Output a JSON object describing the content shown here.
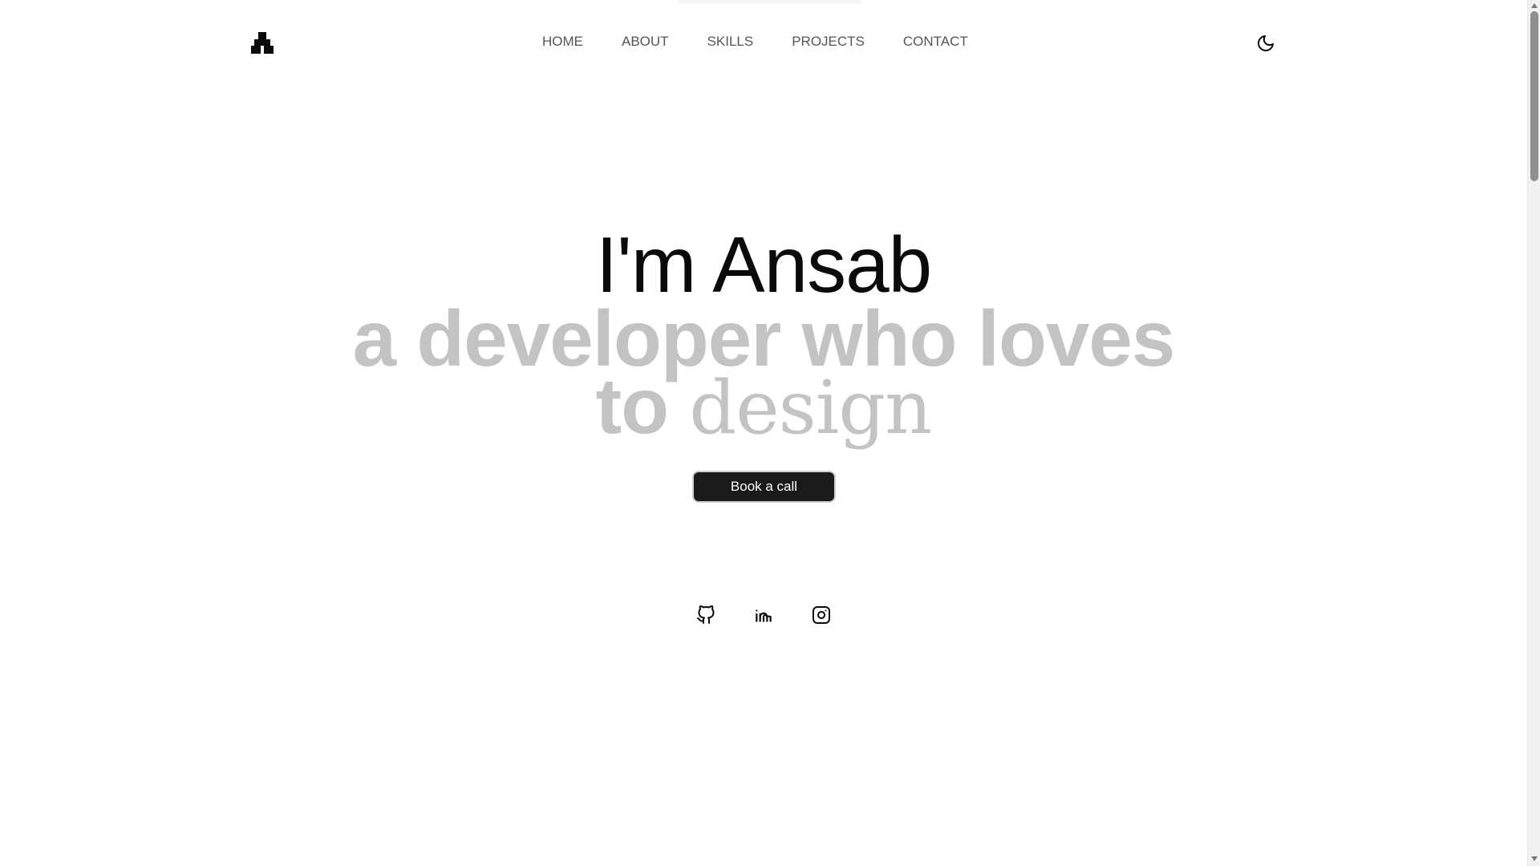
{
  "header": {
    "logo_icon": "stacked-blocks-logo",
    "nav": [
      {
        "label": "HOME"
      },
      {
        "label": "ABOUT"
      },
      {
        "label": "SKILLS"
      },
      {
        "label": "PROJECTS"
      },
      {
        "label": "CONTACT"
      }
    ],
    "theme_toggle_icon": "moon-icon"
  },
  "hero": {
    "title": "I'm Ansab",
    "subtitle_line1": "a developer who loves",
    "subtitle_line2_sans": "to",
    "subtitle_line2_serif": "design",
    "cta_label": "Book a call"
  },
  "socials": [
    {
      "icon": "github-icon"
    },
    {
      "icon": "linkedin-icon"
    },
    {
      "icon": "instagram-icon"
    }
  ],
  "colors": {
    "background": "#ffffff",
    "title": "#0a0a0a",
    "subtitle": "#c3c3c3",
    "button_bg": "#1a1a1a",
    "nav_text": "#555555"
  }
}
